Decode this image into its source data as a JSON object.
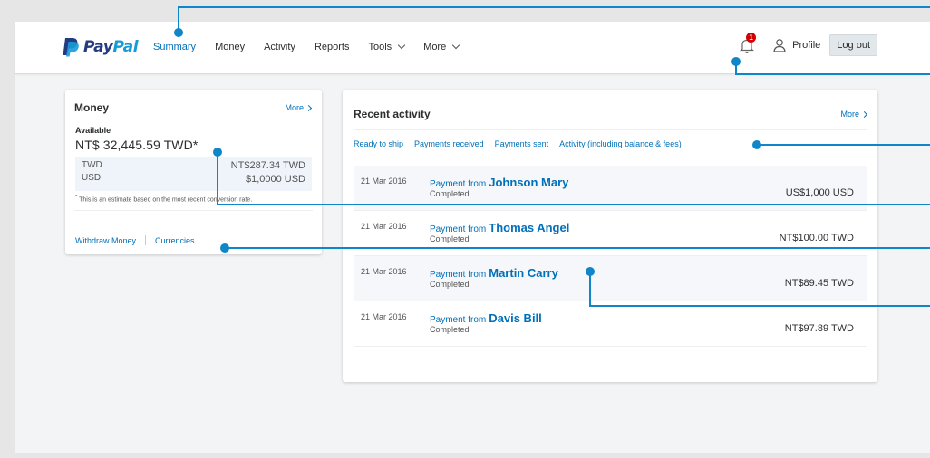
{
  "brand": {
    "name_part1": "Pay",
    "name_part2": "Pal",
    "colors": {
      "dark": "#253b80",
      "light": "#179bd7",
      "link": "#0070ba",
      "callout": "#0e86c9"
    }
  },
  "nav": {
    "items": [
      {
        "label": "Summary",
        "active": true
      },
      {
        "label": "Money"
      },
      {
        "label": "Activity"
      },
      {
        "label": "Reports"
      },
      {
        "label": "Tools"
      },
      {
        "label": "More"
      }
    ]
  },
  "header": {
    "notifications": {
      "icon": "bell-icon",
      "count": "1"
    },
    "profile_label": "Profile",
    "profile_icon": "user-icon",
    "logout_label": "Log out"
  },
  "money_card": {
    "title": "Money",
    "more_label": "More",
    "available_label": "Available",
    "available_value": "NT$ 32,445.59 TWD*",
    "conversions": [
      {
        "currency": "TWD",
        "amount": "NT$287.34 TWD"
      },
      {
        "currency": "USD",
        "amount": "$1,0000 USD"
      }
    ],
    "footnote_mark": "*",
    "footnote": " This is an estimate based on the most recent conversion rate.",
    "links": {
      "withdraw": "Withdraw Money",
      "currencies": "Currencies"
    }
  },
  "activity_card": {
    "title": "Recent activity",
    "more_label": "More",
    "filters": [
      "Ready to ship",
      "Payments received",
      "Payments sent",
      "Activity (including balance & fees)"
    ],
    "rows": [
      {
        "date": "21 Mar 2016",
        "prefix": "Payment from",
        "name": "Johnson Mary",
        "status": "Completed",
        "amount": "US$1,000 USD"
      },
      {
        "date": "21 Mar 2016",
        "prefix": "Payment from",
        "name": "Thomas Angel",
        "status": "Completed",
        "amount": "NT$100.00 TWD"
      },
      {
        "date": "21 Mar 2016",
        "prefix": "Payment from",
        "name": "Martin Carry",
        "status": "Completed",
        "amount": "NT$89.45 TWD"
      },
      {
        "date": "21 Mar 2016",
        "prefix": "Payment from",
        "name": "Davis Bill",
        "status": "Completed",
        "amount": "NT$97.89 TWD"
      }
    ]
  }
}
